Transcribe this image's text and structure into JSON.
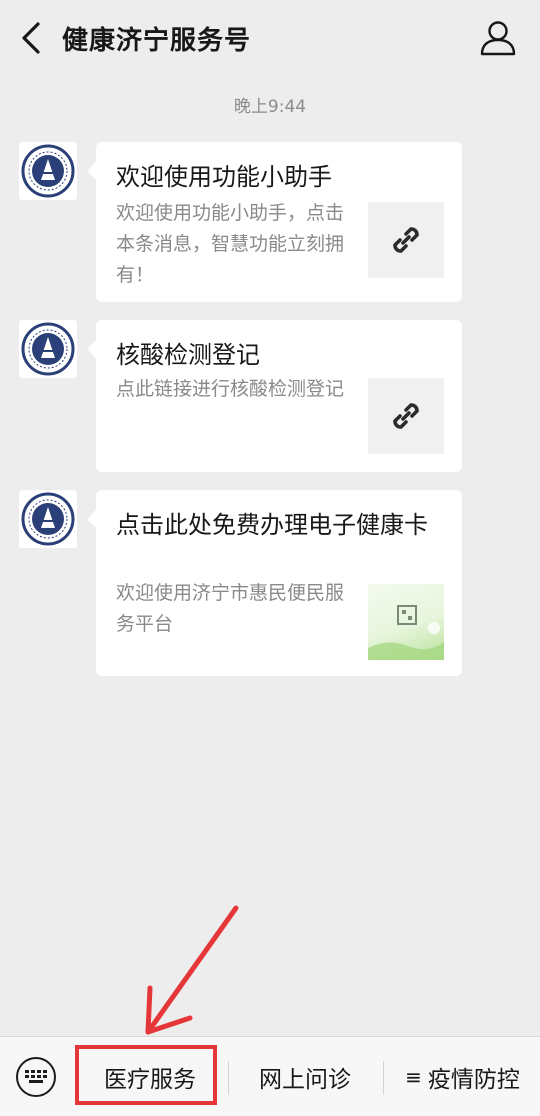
{
  "header": {
    "title": "健康济宁服务号",
    "back_icon": "chevron-left-icon",
    "profile_icon": "user-icon"
  },
  "timestamp": "晚上9:44",
  "messages": [
    {
      "title": "欢迎使用功能小助手",
      "description": "欢迎使用功能小助手，点击本条消息，智慧功能立刻拥有！",
      "thumbnail": "link-icon"
    },
    {
      "title": "核酸检测登记",
      "description": "点此链接进行核酸检测登记",
      "thumbnail": "link-icon"
    },
    {
      "title": "点击此处免费办理电子健康卡",
      "description": "欢迎使用济宁市惠民便民服务平台",
      "thumbnail": "health-card-image"
    }
  ],
  "bottom_menu": {
    "keyboard_icon": "keyboard-icon",
    "items": [
      {
        "label": "医疗服务"
      },
      {
        "label": "网上问诊"
      },
      {
        "label": "疫情防控",
        "icon": "menu-lines-icon",
        "icon_glyph": "≡"
      }
    ]
  },
  "annotation": {
    "highlight_color": "#e5373a",
    "highlighted_item": "医疗服务"
  }
}
